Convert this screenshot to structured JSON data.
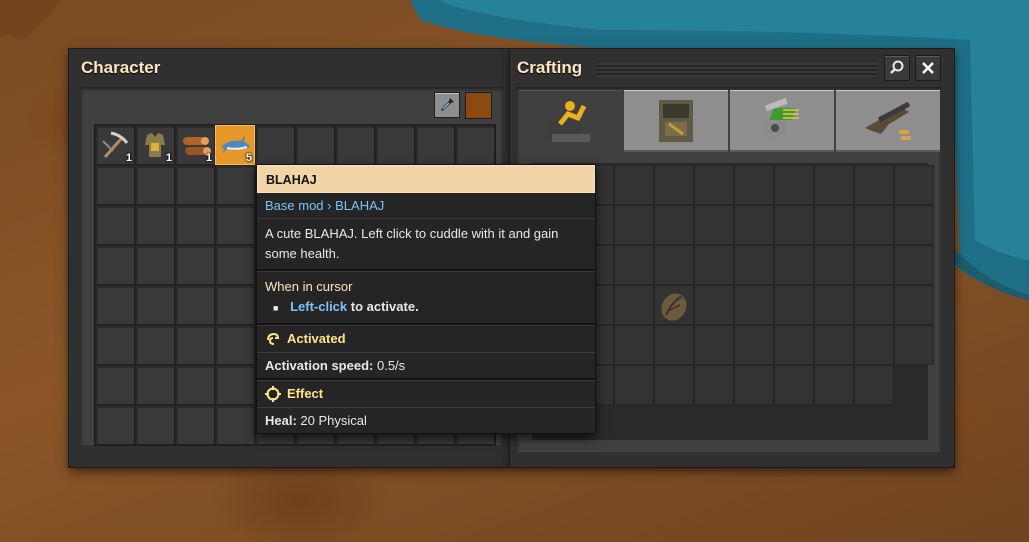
{
  "character": {
    "title": "Character",
    "color_swatch": "#8a4a12",
    "inventory": [
      {
        "icon": "pickaxe-icon",
        "count": "1"
      },
      {
        "icon": "armor-icon",
        "count": "1"
      },
      {
        "icon": "wood-icon",
        "count": "1"
      },
      {
        "icon": "blahaj-shark-icon",
        "count": "5",
        "selected": true
      }
    ]
  },
  "crafting": {
    "title": "Crafting",
    "tabs": [
      {
        "icon": "logistics-icon",
        "active": true
      },
      {
        "icon": "production-icon",
        "active": false
      },
      {
        "icon": "intermediate-products-icon",
        "active": false
      },
      {
        "icon": "combat-icon",
        "active": false
      }
    ]
  },
  "tooltip": {
    "title": "BLAHAJ",
    "source_prefix": "Base mod",
    "source_sep": "›",
    "source_item": "BLAHAJ",
    "description": "A cute BLAHAJ. Left click to cuddle with it and gain some health.",
    "cursor_heading": "When in cursor",
    "cursor_bullet_action": "Left-click",
    "cursor_bullet_rest": "to activate.",
    "activated_heading": "Activated",
    "activation_label": "Activation speed:",
    "activation_value": "0.5/s",
    "effect_heading": "Effect",
    "heal_label": "Heal:",
    "heal_value": "20 Physical"
  },
  "colors": {
    "accent_selected": "#e39827",
    "tooltip_header": "#f2d5a6",
    "link_blue": "#7fc3f5",
    "heading_yellow": "#ffe38a"
  }
}
